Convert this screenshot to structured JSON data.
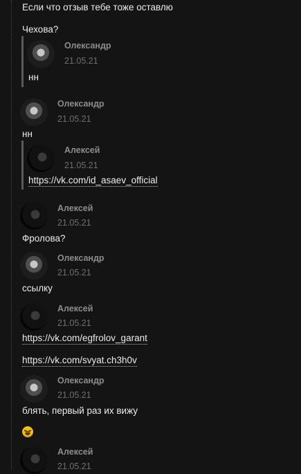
{
  "messages": {
    "intro": "Если что отзыв тебе тоже оставлю",
    "q1": "Чехова?",
    "quote1": {
      "name": "Олександр",
      "date": "21.05.21",
      "text": "нн"
    },
    "msg2": {
      "name": "Олександр",
      "date": "21.05.21",
      "text": "нн"
    },
    "quote2": {
      "name": "Алексей",
      "date": "21.05.21",
      "link": "https://vk.com/id_asaev_official"
    },
    "msg3": {
      "name": "Алексей",
      "date": "21.05.21",
      "text": "Фролова?"
    },
    "msg4": {
      "name": "Олександр",
      "date": "21.05.21",
      "text": "ссылку"
    },
    "msg5": {
      "name": "Алексей",
      "date": "21.05.21",
      "link1": "https://vk.com/egfrolov_garant",
      "link2": "https://vk.com/svyat.ch3h0v"
    },
    "msg6": {
      "name": "Олександр",
      "date": "21.05.21",
      "text": "блять, первый раз их вижу"
    },
    "msg7": {
      "name": "Алексей",
      "date": "21.05.21"
    }
  }
}
